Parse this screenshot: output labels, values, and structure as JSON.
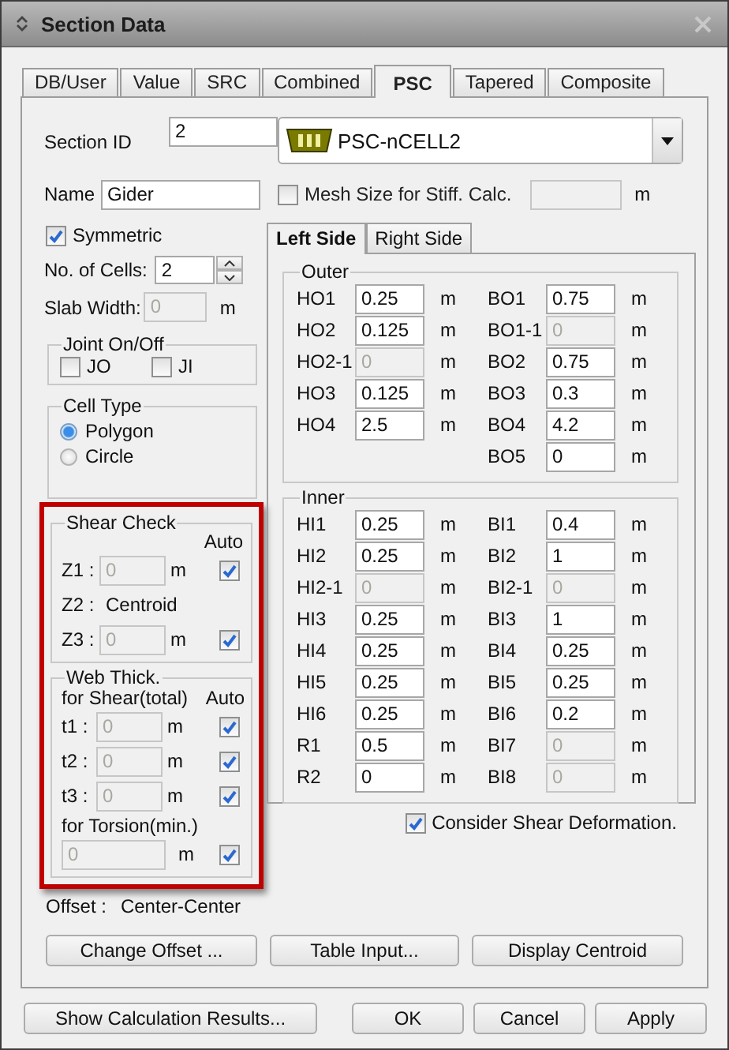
{
  "window": {
    "title": "Section Data"
  },
  "tabs": [
    {
      "label": "DB/User",
      "selected": false
    },
    {
      "label": "Value",
      "selected": false
    },
    {
      "label": "SRC",
      "selected": false
    },
    {
      "label": "Combined",
      "selected": false
    },
    {
      "label": "PSC",
      "selected": true
    },
    {
      "label": "Tapered",
      "selected": false
    },
    {
      "label": "Composite",
      "selected": false
    }
  ],
  "section_id": {
    "label": "Section ID",
    "value": "2"
  },
  "section_type": {
    "value": "PSC-nCELL2"
  },
  "name": {
    "label": "Name",
    "value": "Gider"
  },
  "mesh_size": {
    "label": "Mesh Size for Stiff. Calc.",
    "checked": false,
    "unit": "m"
  },
  "symmetric": {
    "label": "Symmetric",
    "checked": true
  },
  "no_of_cells": {
    "label": "No. of Cells:",
    "value": "2"
  },
  "slab_width": {
    "label": "Slab Width:",
    "value": "0",
    "disabled": true,
    "unit": "m"
  },
  "joint": {
    "title": "Joint On/Off",
    "options": [
      {
        "label": "JO",
        "checked": false
      },
      {
        "label": "JI",
        "checked": false
      }
    ]
  },
  "cell_type": {
    "title": "Cell Type",
    "options": [
      {
        "label": "Polygon",
        "selected": true
      },
      {
        "label": "Circle",
        "selected": false
      }
    ]
  },
  "shear_panel": {
    "highlighted": true,
    "shear_check": {
      "title": "Shear Check",
      "auto_label": "Auto",
      "rows": [
        {
          "kind": "field",
          "label": "Z1 :",
          "value": "0",
          "disabled": true,
          "unit": "m",
          "auto": true
        },
        {
          "kind": "text",
          "label": "Z2 :",
          "value": "Centroid"
        },
        {
          "kind": "field",
          "label": "Z3 :",
          "value": "0",
          "disabled": true,
          "unit": "m",
          "auto": true
        }
      ]
    },
    "web_thick": {
      "title": "Web Thick.",
      "subtitle": "for Shear(total)",
      "auto_label": "Auto",
      "rows": [
        {
          "label": "t1 :",
          "value": "0",
          "disabled": true,
          "unit": "m",
          "auto": true
        },
        {
          "label": "t2 :",
          "value": "0",
          "disabled": true,
          "unit": "m",
          "auto": true
        },
        {
          "label": "t3 :",
          "value": "0",
          "disabled": true,
          "unit": "m",
          "auto": true
        }
      ],
      "torsion": {
        "label": "for Torsion(min.)",
        "value": "0",
        "disabled": true,
        "unit": "m",
        "auto": true
      }
    }
  },
  "offset": {
    "label": "Offset :",
    "value": "Center-Center"
  },
  "side_tabs": [
    {
      "label": "Left Side",
      "selected": true
    },
    {
      "label": "Right Side",
      "selected": false
    }
  ],
  "outer": {
    "title": "Outer",
    "left": [
      {
        "label": "HO1",
        "value": "0.25",
        "disabled": false,
        "unit": "m"
      },
      {
        "label": "HO2",
        "value": "0.125",
        "disabled": false,
        "unit": "m"
      },
      {
        "label": "HO2-1",
        "value": "0",
        "disabled": true,
        "unit": "m"
      },
      {
        "label": "HO3",
        "value": "0.125",
        "disabled": false,
        "unit": "m"
      },
      {
        "label": "HO4",
        "value": "2.5",
        "disabled": false,
        "unit": "m"
      }
    ],
    "right": [
      {
        "label": "BO1",
        "value": "0.75",
        "disabled": false,
        "unit": "m"
      },
      {
        "label": "BO1-1",
        "value": "0",
        "disabled": true,
        "unit": "m"
      },
      {
        "label": "BO2",
        "value": "0.75",
        "disabled": false,
        "unit": "m"
      },
      {
        "label": "BO3",
        "value": "0.3",
        "disabled": false,
        "unit": "m"
      },
      {
        "label": "BO4",
        "value": "4.2",
        "disabled": false,
        "unit": "m"
      },
      {
        "label": "BO5",
        "value": "0",
        "disabled": false,
        "unit": "m"
      }
    ]
  },
  "inner": {
    "title": "Inner",
    "left": [
      {
        "label": "HI1",
        "value": "0.25",
        "disabled": false,
        "unit": "m"
      },
      {
        "label": "HI2",
        "value": "0.25",
        "disabled": false,
        "unit": "m"
      },
      {
        "label": "HI2-1",
        "value": "0",
        "disabled": true,
        "unit": "m"
      },
      {
        "label": "HI3",
        "value": "0.25",
        "disabled": false,
        "unit": "m"
      },
      {
        "label": "HI4",
        "value": "0.25",
        "disabled": false,
        "unit": "m"
      },
      {
        "label": "HI5",
        "value": "0.25",
        "disabled": false,
        "unit": "m"
      },
      {
        "label": "HI6",
        "value": "0.25",
        "disabled": false,
        "unit": "m"
      },
      {
        "label": "R1",
        "value": "0.5",
        "disabled": false,
        "unit": "m"
      },
      {
        "label": "R2",
        "value": "0",
        "disabled": false,
        "unit": "m"
      }
    ],
    "right": [
      {
        "label": "BI1",
        "value": "0.4",
        "disabled": false,
        "unit": "m"
      },
      {
        "label": "BI2",
        "value": "1",
        "disabled": false,
        "unit": "m"
      },
      {
        "label": "BI2-1",
        "value": "0",
        "disabled": true,
        "unit": "m"
      },
      {
        "label": "BI3",
        "value": "1",
        "disabled": false,
        "unit": "m"
      },
      {
        "label": "BI4",
        "value": "0.25",
        "disabled": false,
        "unit": "m"
      },
      {
        "label": "BI5",
        "value": "0.25",
        "disabled": false,
        "unit": "m"
      },
      {
        "label": "BI6",
        "value": "0.2",
        "disabled": false,
        "unit": "m"
      },
      {
        "label": "BI7",
        "value": "0",
        "disabled": true,
        "unit": "m"
      },
      {
        "label": "BI8",
        "value": "0",
        "disabled": true,
        "unit": "m"
      }
    ]
  },
  "consider_shear": {
    "label": "Consider Shear Deformation.",
    "checked": true
  },
  "panel_buttons": [
    "Change Offset ...",
    "Table Input...",
    "Display Centroid"
  ],
  "footer_buttons": [
    "Show Calculation Results...",
    "OK",
    "Cancel",
    "Apply"
  ]
}
